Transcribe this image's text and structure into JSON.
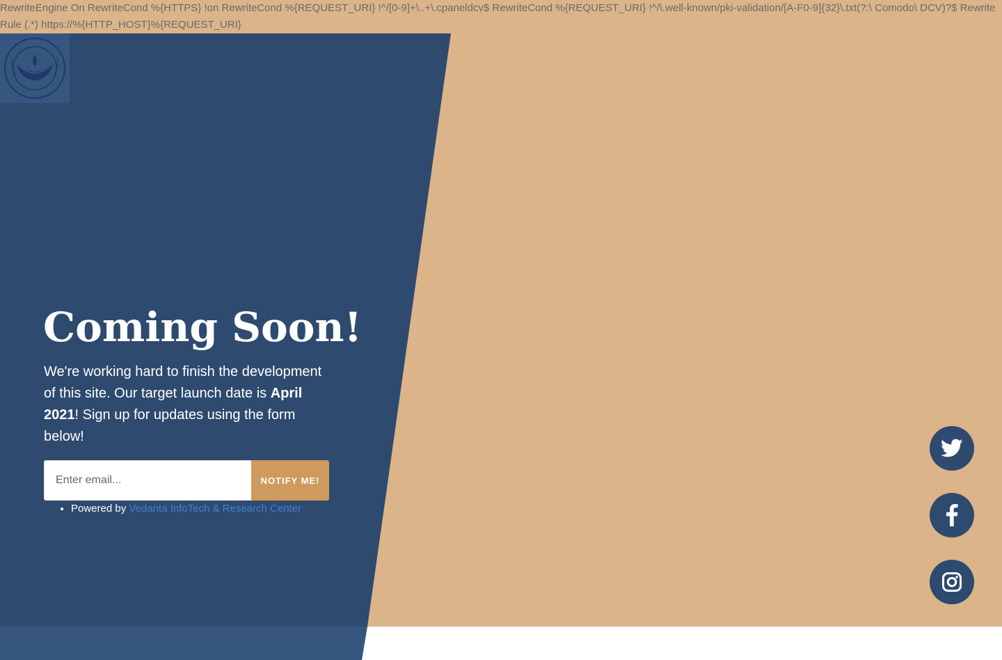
{
  "top_banner": {
    "text": "RewriteEngine On RewriteCond %{HTTPS} !on RewriteCond %{REQUEST_URI} !^/[0-9]+\\..+\\.cpaneldcv$ RewriteCond %{REQUEST_URI} !^/\\.well-known/pki-validation/[A-F0-9]{32}\\.txt(?:\\ Comodo\\ DCV)?$ RewriteRule (.*) https://%{HTTP_HOST}%{REQUEST_URI}"
  },
  "hero": {
    "title": "Coming Soon!",
    "description_before": "We're working hard to finish the development of this site. Our target launch date is ",
    "launch_date": "April 2021",
    "description_after": "! Sign up for updates using the form below!"
  },
  "signup": {
    "email_placeholder": "Enter email...",
    "email_value": "",
    "notify_label": "NOTIFY ME!"
  },
  "footer": {
    "powered_prefix": "Powered by ",
    "powered_link": "Vedanta InfoTech & Research Center"
  },
  "social": {
    "items": [
      {
        "name": "twitter",
        "icon": "twitter-icon"
      },
      {
        "name": "facebook",
        "icon": "facebook-icon"
      },
      {
        "name": "instagram",
        "icon": "instagram-icon"
      }
    ]
  },
  "colors": {
    "panel_blue": "#2e4a6e",
    "accent_tan": "#dbb489",
    "button_orange": "#cf9a5d",
    "link_blue": "#3f80d6"
  }
}
